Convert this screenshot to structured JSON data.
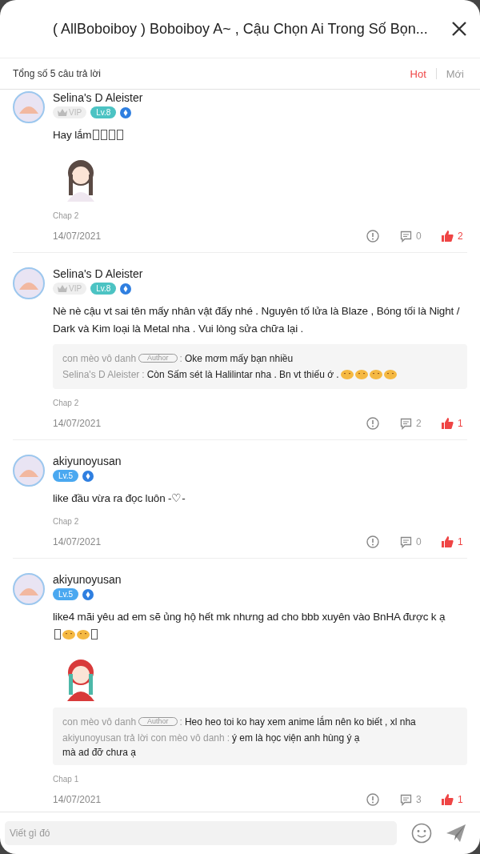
{
  "header": {
    "title": "( AllBoboiboy ) Boboiboy A~ , Cậu Chọn Ai Trong Số Bọn..."
  },
  "summary": "Tổng số 5 câu trả lời",
  "tabs": [
    {
      "label": "Hot",
      "selected": true
    },
    {
      "label": "Mới",
      "selected": false
    }
  ],
  "comments": [
    {
      "name": "Selina's D Aleister",
      "vip": true,
      "vip_label": "VIP",
      "level": "Lv.8",
      "color": "#4cc3c3",
      "text": "Hay lắm",
      "tail": [
        {
          "kind": "box"
        },
        {
          "kind": "box"
        },
        {
          "kind": "box"
        },
        {
          "kind": "box"
        }
      ],
      "chap": "Chap 2",
      "date": "14/07/2021",
      "reply_count": "0",
      "like_count": "2",
      "liked": true
    },
    {
      "name": "Selina's D Aleister",
      "vip": true,
      "vip_label": "VIP",
      "level": "Lv.8",
      "color": "#4cc3c3",
      "text": "Nè nè cậu vt sai tên mấy nhân vật đấy nhé . Nguyên tố lửa là Blaze , Bóng tối là Night / Dark và Kim loại là Metal nha . Vui lòng sửa chữa lại .",
      "replies": [
        {
          "name": "con mèo vô danh",
          "author": true,
          "badge": "Author",
          "sep": ":",
          "text": "Oke mơm mấy bạn nhiều"
        },
        {
          "name": "Selina's D Aleister",
          "author": false,
          "sep": ":",
          "text": "Còn Sấm sét là Halilintar nha . Bn vt thiếu ớ .",
          "tail": [
            {
              "kind": "emoji"
            },
            {
              "kind": "emoji"
            },
            {
              "kind": "emoji"
            },
            {
              "kind": "emoji"
            }
          ]
        }
      ],
      "chap": "Chap 2",
      "date": "14/07/2021",
      "reply_count": "2",
      "like_count": "1",
      "liked": true
    },
    {
      "name": "akiyunoyusan",
      "vip": false,
      "level": "Lv.5",
      "color": "#4aa8f0",
      "text": "like đầu vừa ra đọc luôn -♡-",
      "chap": "Chap 2",
      "date": "14/07/2021",
      "reply_count": "0",
      "like_count": "1",
      "liked": true
    },
    {
      "name": "akiyunoyusan",
      "vip": false,
      "level": "Lv.5",
      "color": "#4aa8f0",
      "text": "like4 mãi yêu ad em sẽ ủng hộ hết mk nhưng ad cho bbb xuyên vào BnHA được k ạ",
      "tail": [
        {
          "kind": "box"
        },
        {
          "kind": "emoji"
        },
        {
          "kind": "emoji"
        },
        {
          "kind": "box"
        }
      ],
      "tail_on_new_line": true,
      "replies": [
        {
          "name": "con mèo vô danh",
          "author": true,
          "badge": "Author",
          "sep": ":",
          "text": "Heo heo toi ko hay xem anime lắm nên ko biết , xl nha"
        },
        {
          "name": "akiyunoyusan trả lời con mèo vô danh",
          "author": false,
          "sep": ":",
          "text": "ý em là học viện anh hùng ý ạ",
          "next_lines": [
            "mà ad đỡ chưa ạ"
          ]
        }
      ],
      "chap": "Chap 1",
      "date": "14/07/2021",
      "reply_count": "3",
      "like_count": "1",
      "liked": true
    }
  ],
  "composer": {
    "placeholder": "Viết gì đó"
  }
}
